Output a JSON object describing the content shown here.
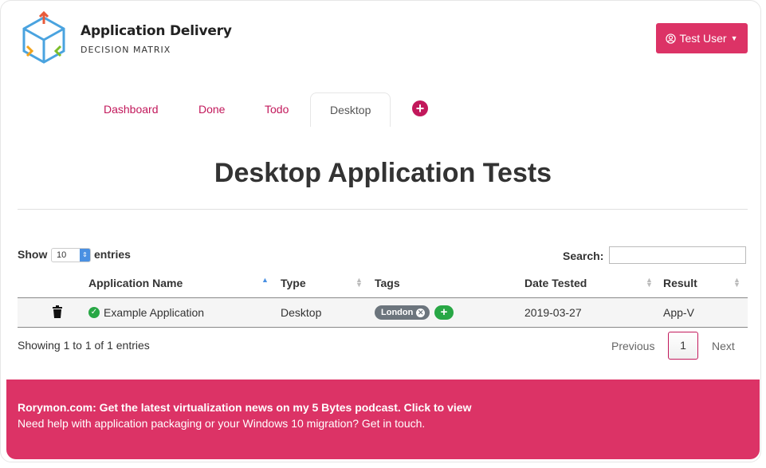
{
  "brand": {
    "title": "Application Delivery",
    "subtitle": "DECISION MATRIX"
  },
  "user_menu": {
    "label": "Test User"
  },
  "tabs": [
    {
      "label": "Dashboard"
    },
    {
      "label": "Done"
    },
    {
      "label": "Todo"
    },
    {
      "label": "Desktop",
      "active": true
    }
  ],
  "page_title": "Desktop Application Tests",
  "table_controls": {
    "show": "Show",
    "entries_value": "10",
    "entries": "entries",
    "search_label": "Search:",
    "search_value": ""
  },
  "table": {
    "columns": [
      "Application Name",
      "Type",
      "Tags",
      "Date Tested",
      "Result"
    ],
    "rows": [
      {
        "name": "Example Application",
        "type": "Desktop",
        "tags": [
          "London"
        ],
        "date": "2019-03-27",
        "result": "App-V"
      }
    ]
  },
  "pagination": {
    "info": "Showing 1 to 1 of 1 entries",
    "previous": "Previous",
    "current": "1",
    "next": "Next"
  },
  "footer": {
    "line1": "Rorymon.com: Get the latest virtualization news on my 5 Bytes podcast. Click to view",
    "line2": "Need help with application packaging or your Windows 10 migration? Get in touch."
  },
  "colors": {
    "accent": "#dc3366",
    "tab_link": "#c2185b",
    "success": "#28a745",
    "tag": "#6c757d"
  },
  "icons": [
    "cube-logo-icon",
    "user-circle-icon",
    "caret-down-icon",
    "plus-circle-icon",
    "sort-icon",
    "trash-icon",
    "check-circle-icon",
    "remove-tag-icon",
    "add-tag-icon"
  ]
}
